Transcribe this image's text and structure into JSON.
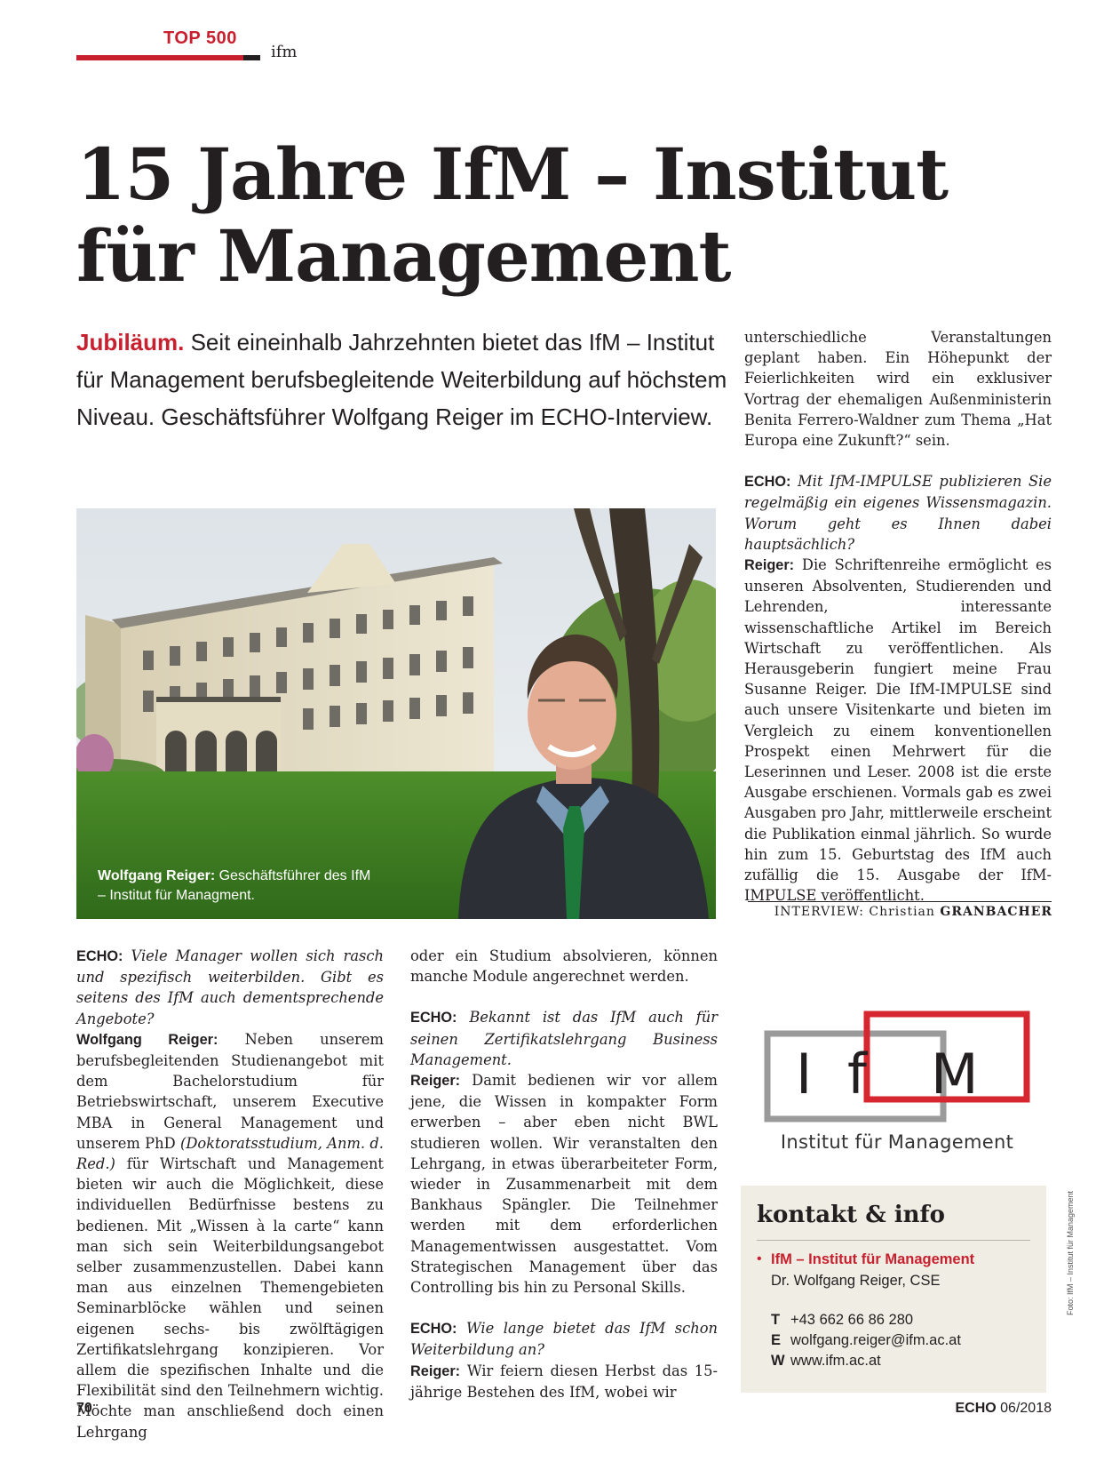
{
  "header": {
    "section": "TOP 500",
    "subsection": "ifm"
  },
  "title": {
    "line1": "15 Jahre IfM – Institut",
    "line2": "für Management"
  },
  "lead": {
    "keyword": "Jubiläum.",
    "text": "Seit eineinhalb Jahrzehnten bietet das IfM – Institut für Management berufsbegleitende Weiterbildung auf höchstem Niveau. Geschäftsführer Wolfgang Reiger im ECHO-Interview."
  },
  "photo": {
    "caption_name": "Wolfgang Reiger:",
    "caption_text": "Geschäftsführer des IfM – Institut für Managment."
  },
  "article": {
    "col1": {
      "echo_label": "ECHO:",
      "question1": "Viele Manager wollen sich rasch und spezifisch weiterbilden. Gibt es seitens des IfM auch dementsprechende Angebote?",
      "answer1_label": "Wolfgang Reiger:",
      "answer1_a": "Neben unserem berufsbegleitenden Studienangebot mit dem Bachelorstudium für Betriebswirtschaft, unserem Executive MBA in General Management und unserem PhD",
      "answer1_note": "(Doktoratsstudium, Anm. d. Red.)",
      "answer1_b": "für Wirtschaft und Management bieten wir auch die Möglichkeit, diese individuellen Bedürfnisse bestens zu bedienen. Mit „Wissen à la carte“ kann man sich sein Weiterbildungsangebot selber zusammenzustellen. Dabei kann man aus einzelnen Themengebieten Seminarblöcke wählen und seinen eigenen sechs- bis zwölftägigen Zertifikatslehrgang konzipieren. Vor allem die spezifischen Inhalte und die Flexibilität sind den Teilnehmern wichtig. Möchte man anschließend doch einen Lehrgang"
    },
    "col2": {
      "continuation": "oder ein Studium absolvieren, können manche Module angerechnet werden.",
      "echo_label_2": "ECHO:",
      "question2": "Bekannt ist das IfM auch für seinen Zertifikatslehrgang Business Management.",
      "answer2_label": "Reiger:",
      "answer2": "Damit bedienen wir vor allem jene, die Wissen in kompakter Form erwerben – aber eben nicht BWL studieren wollen. Wir veranstalten den Lehrgang, in etwas überarbeiteter Form, wieder in Zusammenarbeit mit dem Bankhaus Spängler. Die Teilnehmer werden mit dem erforderlichen Managementwissen ausgestattet. Vom Strategischen Management über das Controlling bis hin zu Personal Skills.",
      "echo_label_3": "ECHO:",
      "question3": "Wie lange bietet das IfM schon Weiterbildung an?",
      "answer3_label": "Reiger:",
      "answer3": "Wir feiern diesen Herbst das 15-jährige Bestehen des IfM, wobei wir"
    },
    "col3": {
      "continuation": "unterschiedliche Veranstaltungen geplant haben. Ein Höhepunkt der Feierlichkeiten wird ein exklusiver Vortrag der ehemaligen Außenministerin Benita Ferrero-Waldner zum Thema „Hat Europa eine Zukunft?“ sein.",
      "echo_label_4": "ECHO:",
      "question4": "Mit IfM-IMPULSE publizieren Sie regelmäßig ein eigenes Wissensmagazin. Worum geht es Ihnen dabei hauptsächlich?",
      "answer4_label": "Reiger:",
      "answer4": "Die Schriftenreihe ermöglicht es unseren Absolventen, Studierenden und Lehrenden, interessante wissenschaftliche Artikel im Bereich Wirtschaft zu veröffentlichen. Als Herausgeberin fungiert meine Frau Susanne Reiger. Die IfM-IMPULSE sind auch unsere Visitenkarte und bieten im Vergleich zu einem konventionellen Prospekt einen Mehrwert für die Leserinnen und Leser. 2008 ist die erste Ausgabe erschienen. Vormals gab es zwei Ausgaben pro Jahr, mittlerweile erscheint die Publikation einmal jährlich. So wurde hin zum 15. Geburtstag des IfM auch zufällig die 15. Ausgabe der IfM-IMPULSE veröffentlicht."
    },
    "interview_label": "INTERVIEW: Christian",
    "interview_name": "GRANBACHER"
  },
  "logo": {
    "letters": "IfM",
    "subtitle": "Institut für Management"
  },
  "kontakt": {
    "title": "kontakt & info",
    "bullet": "•",
    "org": "IfM – Institut für Management",
    "person": "Dr. Wolfgang Reiger, CSE",
    "phone_label": "T",
    "phone": "+43 662 66 86 280",
    "email_label": "E",
    "email": "wolfgang.reiger@ifm.ac.at",
    "web_label": "W",
    "web": "www.ifm.ac.at"
  },
  "credit": "Foto: IfM – Institut für Management",
  "footer": {
    "page_number": "70",
    "magazine": "ECHO",
    "issue": "06/2018"
  },
  "colors": {
    "accent": "#c8202e",
    "text": "#231f20",
    "box": "#f0ede5"
  }
}
